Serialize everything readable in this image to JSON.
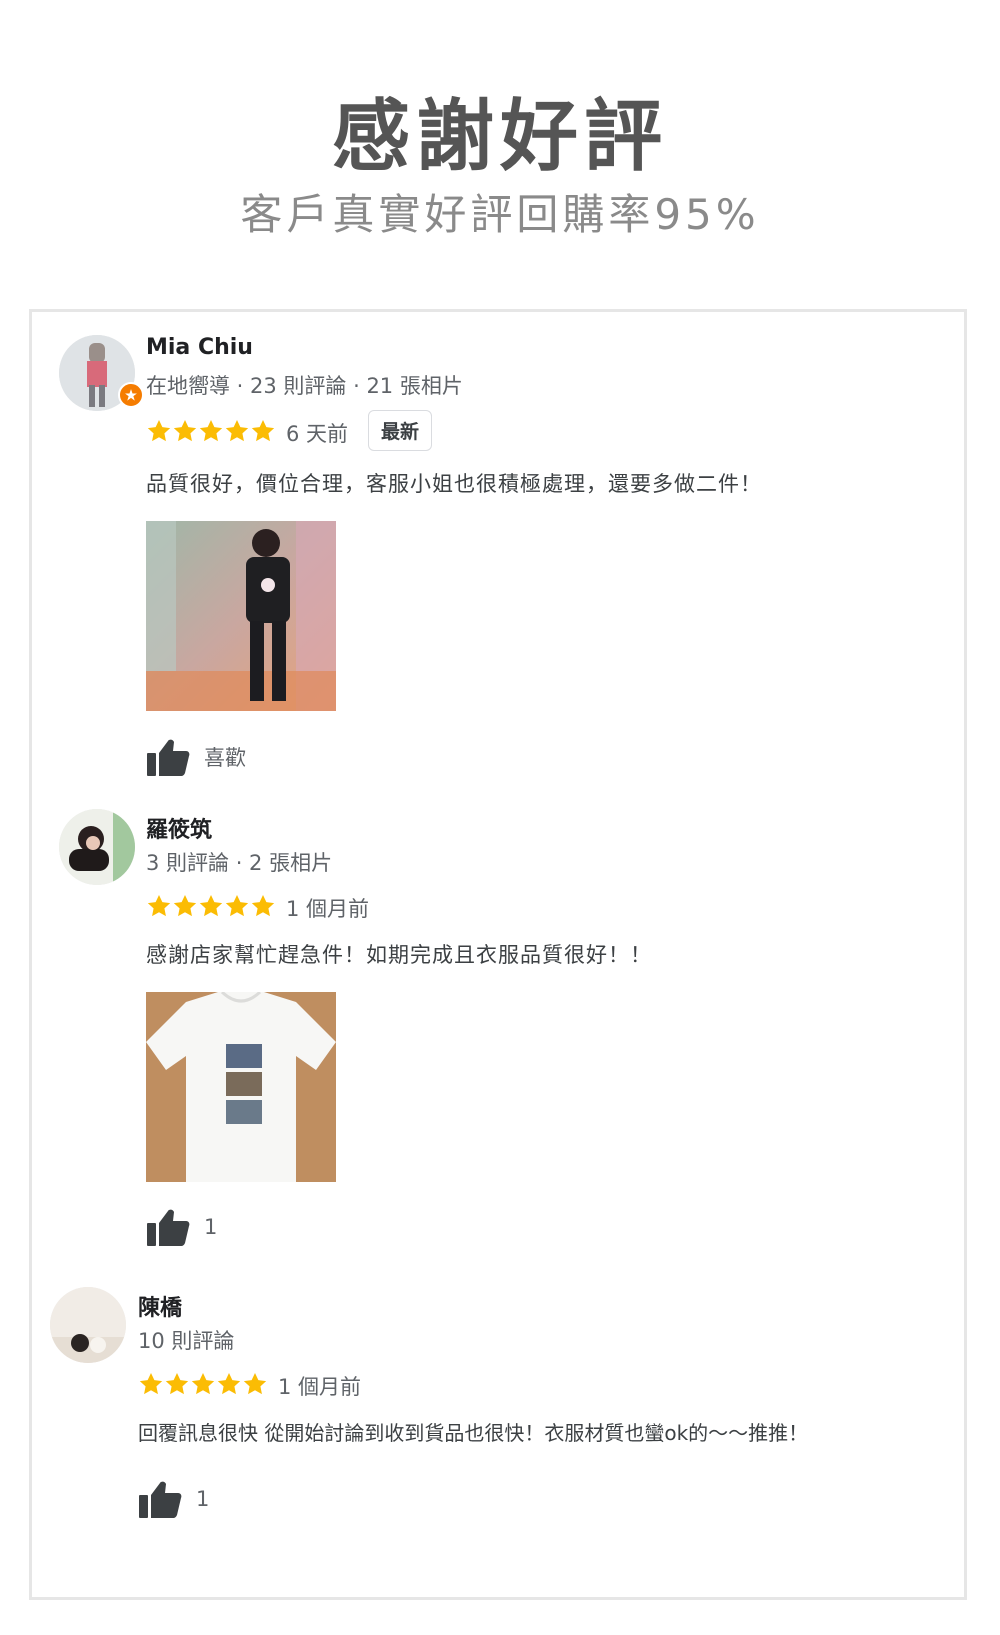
{
  "header": {
    "title": "感謝好評",
    "subtitle": "客戶真實好評回購率95%"
  },
  "colors": {
    "star": "#fbbc04",
    "title": "#555555",
    "subtitle": "#8a8a8a",
    "badge": "#f57c00"
  },
  "reviews": [
    {
      "name": "Mia Chiu",
      "meta": "在地嚮導 · 23 則評論 · 21 張相片",
      "rating": 5,
      "time": "6 天前",
      "tag": "最新",
      "text": "品質很好，價位合理，客服小姐也很積極處理，還要多做二件！",
      "photo": "selfie-photo",
      "like_label": "喜歡"
    },
    {
      "name": "羅筱筑",
      "meta": "3 則評論 · 2 張相片",
      "rating": 5,
      "time": "1 個月前",
      "text": "感謝店家幫忙趕急件！如期完成且衣服品質很好！！",
      "photo": "tshirt-photo",
      "like_label": "1"
    },
    {
      "name": "陳橋",
      "meta": "10 則評論",
      "rating": 5,
      "time": "1 個月前",
      "text": "回覆訊息很快 從開始討論到收到貨品也很快！衣服材質也蠻ok的～～推推！",
      "like_label": "1"
    }
  ]
}
